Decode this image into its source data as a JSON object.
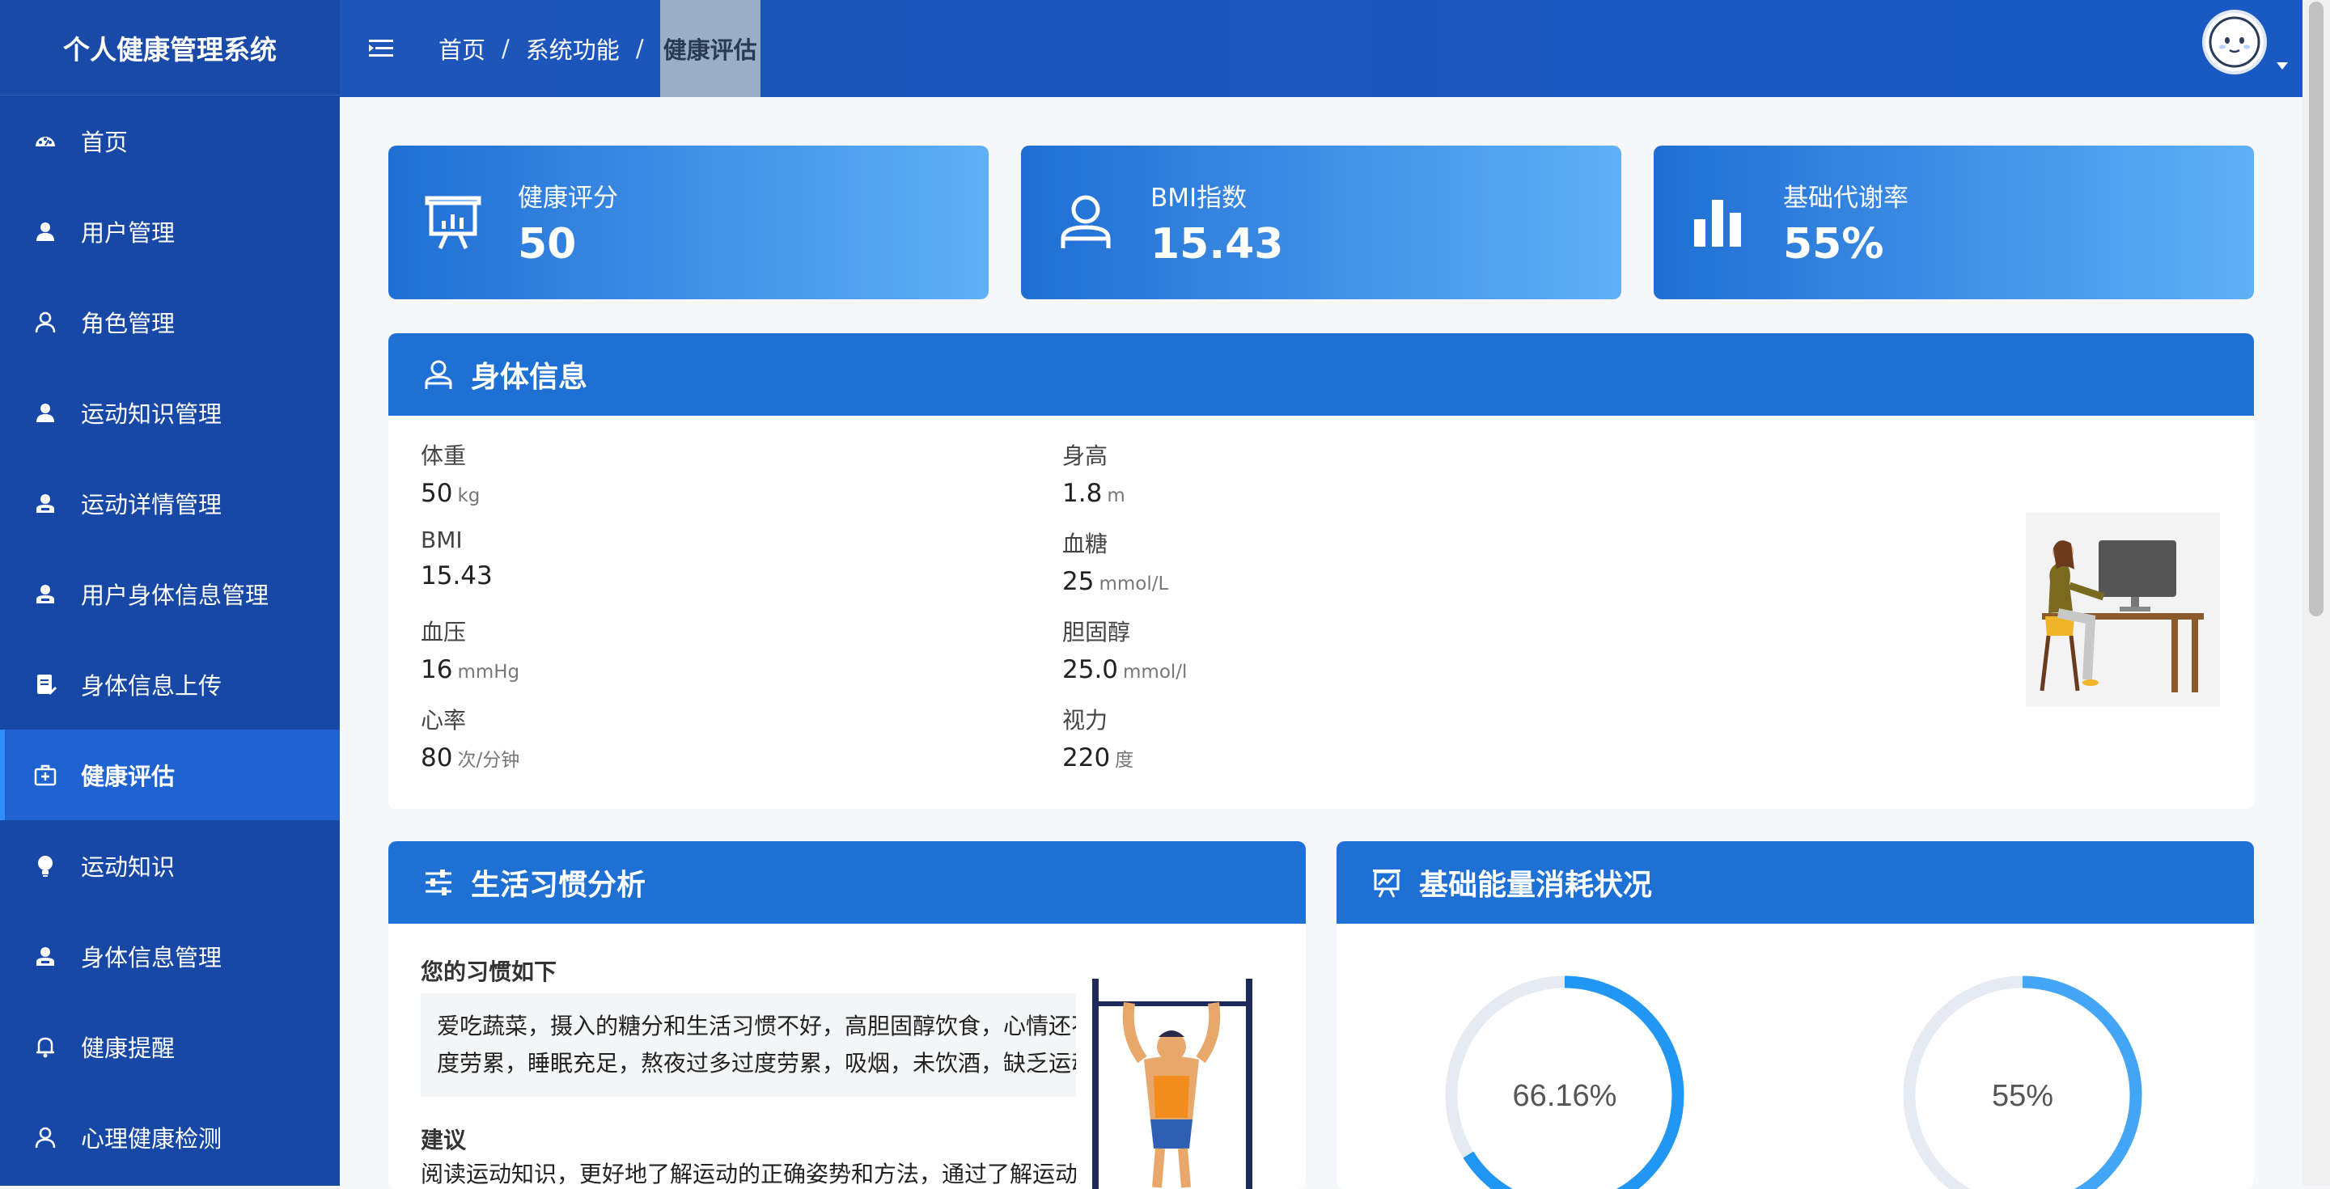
{
  "app": {
    "title": "个人健康管理系统"
  },
  "sidebar": {
    "items": [
      {
        "label": "首页",
        "icon": "dashboard-icon"
      },
      {
        "label": "用户管理",
        "icon": "user-icon"
      },
      {
        "label": "角色管理",
        "icon": "user-outline-icon"
      },
      {
        "label": "运动知识管理",
        "icon": "user-icon"
      },
      {
        "label": "运动详情管理",
        "icon": "user-badge-icon"
      },
      {
        "label": "用户身体信息管理",
        "icon": "user-badge-icon"
      },
      {
        "label": "身体信息上传",
        "icon": "document-edit-icon"
      },
      {
        "label": "健康评估",
        "icon": "medical-box-icon",
        "active": true
      },
      {
        "label": "运动知识",
        "icon": "bulb-icon"
      },
      {
        "label": "身体信息管理",
        "icon": "user-badge-icon"
      },
      {
        "label": "健康提醒",
        "icon": "bell-icon"
      },
      {
        "label": "心理健康检测",
        "icon": "user-outline-icon"
      }
    ]
  },
  "breadcrumb": {
    "home": "首页",
    "section": "系统功能",
    "current": "健康评估",
    "separator": "/"
  },
  "stats": [
    {
      "label": "健康评分",
      "value": "50",
      "icon": "presentation-board-icon"
    },
    {
      "label": "BMI指数",
      "value": "15.43",
      "icon": "person-icon"
    },
    {
      "label": "基础代谢率",
      "value": "55%",
      "icon": "bar-chart-icon"
    }
  ],
  "body_info": {
    "title": "身体信息",
    "fields": [
      {
        "label": "体重",
        "value": "50",
        "unit": "kg"
      },
      {
        "label": "身高",
        "value": "1.8",
        "unit": "m"
      },
      {
        "label": "BMI",
        "value": "15.43",
        "unit": ""
      },
      {
        "label": "血糖",
        "value": "25",
        "unit": "mmol/L"
      },
      {
        "label": "血压",
        "value": "16",
        "unit": "mmHg"
      },
      {
        "label": "胆固醇",
        "value": "25.0",
        "unit": "mmol/l"
      },
      {
        "label": "心率",
        "value": "80",
        "unit": "次/分钟"
      },
      {
        "label": "视力",
        "value": "220",
        "unit": "度"
      }
    ]
  },
  "habits": {
    "title": "生活习惯分析",
    "subtitle": "您的习惯如下",
    "text_line1": "爱吃蔬菜，摄入的糖分和生活习惯不好，高胆固醇饮食，心情还不",
    "text_line2": "度劳累，睡眠充足，熬夜过多过度劳累，吸烟，未饮酒，缺乏运动",
    "suggestion_title": "建议",
    "suggestion_text": "阅读运动知识，更好地了解运动的正确姿势和方法，通过了解运动"
  },
  "energy": {
    "title": "基础能量消耗状况",
    "rings": [
      {
        "label": "66.16%",
        "fraction": 0.6616,
        "color": "#2196f3"
      },
      {
        "label": "55%",
        "fraction": 0.55,
        "color": "#42a5f5"
      }
    ]
  }
}
